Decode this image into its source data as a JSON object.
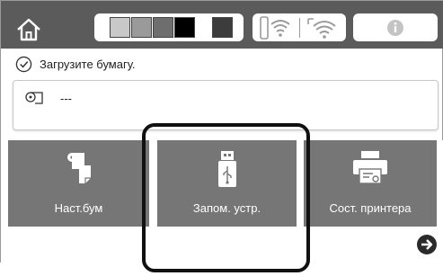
{
  "status_bar": {
    "home_icon": "home-icon",
    "ink_levels": [
      {
        "color": "#c8c8c8",
        "level": 1.0
      },
      {
        "color": "#9a9a9a",
        "level": 1.0
      },
      {
        "color": "#6e6e6e",
        "level": 1.0
      },
      {
        "color": "#000000",
        "level": 1.0
      },
      {
        "color": "#ffffff",
        "level": 0.0
      },
      {
        "color": "#3c3c3c",
        "level": 1.0
      }
    ],
    "wifi_icons": [
      "wifi-direct-icon",
      "wifi-icon"
    ],
    "info_icon": "info-icon"
  },
  "message": {
    "icon": "check-circle-icon",
    "text": "Загрузите бумагу."
  },
  "paper_info": {
    "icon": "paper-roll-icon",
    "value": "---"
  },
  "tiles": [
    {
      "icon": "paper-setting-icon",
      "label": "Наст.бум"
    },
    {
      "icon": "usb-drive-icon",
      "label": "Запом. устр."
    },
    {
      "icon": "printer-status-icon",
      "label": "Сост. принтера"
    }
  ],
  "navigation": {
    "next_icon": "arrow-right-circle-icon"
  },
  "colors": {
    "bar_bg": "#5b5b5b",
    "tile_bg": "#767676",
    "highlight": "#111111"
  }
}
